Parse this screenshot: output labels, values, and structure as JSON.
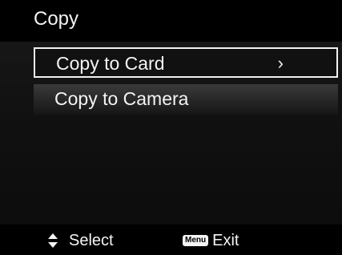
{
  "header": {
    "title": "Copy"
  },
  "menu": {
    "items": [
      {
        "label": "Copy to Card",
        "chevron": "›",
        "selected": true
      },
      {
        "label": "Copy to Camera",
        "selected": false
      }
    ]
  },
  "footer": {
    "select_icon": "up-down-arrows-icon",
    "select_label": "Select",
    "menu_key_label": "Menu",
    "exit_label": "Exit"
  },
  "colors": {
    "background": "#000000",
    "text": "#f4f4f4",
    "selection_border": "#f2f2f2"
  }
}
